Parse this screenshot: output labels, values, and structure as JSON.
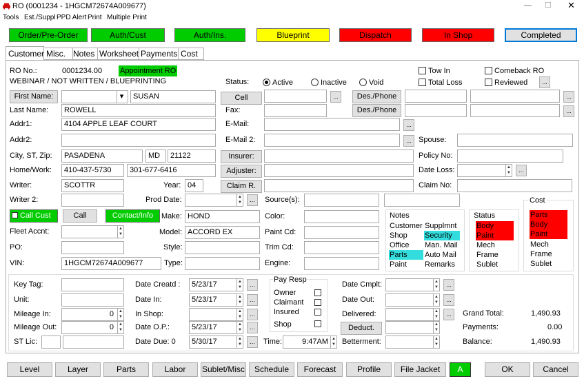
{
  "window": {
    "title": "RO (0001234 - 1HGCM72674A009677)",
    "minimize": "—",
    "maximize": "☐",
    "close": "✕"
  },
  "menu": [
    "Tools",
    "Est./Suppl",
    "PPD Alert",
    "Print",
    "Multiple Print"
  ],
  "topbuttons": [
    {
      "label": "Order/Pre-Order",
      "color": "#00cc00"
    },
    {
      "label": "Auth/Cust",
      "color": "#00cc00"
    },
    {
      "label": "Auth/Ins.",
      "color": "#00cc00"
    },
    {
      "label": "Blueprint",
      "color": "#ffff00"
    },
    {
      "label": "Dispatch",
      "color": "#ff0000"
    },
    {
      "label": "In Shop",
      "color": "#ff0000"
    },
    {
      "label": "Completed",
      "color": "#e1e1e1"
    }
  ],
  "tabs": [
    "Customer",
    "Misc.",
    "Notes",
    "Worksheet",
    "Payments",
    "Cost"
  ],
  "header": {
    "ro_label": "RO No.:",
    "ro_value": "0001234.00",
    "appointment": "Appointment RO",
    "subtitle": "WEBINAR / NOT WRITTEN / BLUEPRINTING",
    "status_label": "Status:",
    "radio_active": "Active",
    "radio_inactive": "Inactive",
    "radio_void": "Void",
    "tow_in": "Tow In",
    "total_loss": "Total Loss",
    "comeback": "Comeback RO",
    "reviewed": "Reviewed",
    "ellipsis": "..."
  },
  "customer": {
    "first_name_btn": "First Name:",
    "first_name": "SUSAN",
    "first_name_title": "",
    "last_name_label": "Last Name:",
    "last_name": "ROWELL",
    "addr1_label": "Addr1:",
    "addr1": "4104 APPLE LEAF COURT",
    "addr2_label": "Addr2:",
    "addr2": "",
    "csz_label": "City, ST, Zip:",
    "city": "PASADENA",
    "state": "MD",
    "zip": "21122",
    "hw_label": "Home/Work:",
    "home": "410-437-5730",
    "work": "301-677-6416",
    "writer_label": "Writer:",
    "writer": "SCOTTR",
    "writer2_label": "Writer 2:",
    "writer2": "",
    "call_cust": "Call Cust",
    "call": "Call",
    "contact_info": "Contact/Info",
    "fleet_label": "Fleet Accnt:",
    "po_label": "PO:",
    "vin_label": "VIN:",
    "vin": "1HGCM72674A009677",
    "cell_btn": "Cell",
    "fax_label": "Fax:",
    "email_label": "E-Mail:",
    "email2_label": "E-Mail 2:",
    "insurer_btn": "Insurer:",
    "adjuster_btn": "Adjuster:",
    "claim_btn": "Claim R.",
    "desphone1": "Des./Phone",
    "desphone2": "Des./Phone",
    "spouse_label": "Spouse:",
    "policy_label": "Policy No:",
    "dateloss_label": "Date Loss:",
    "claimno_label": "Claim No:",
    "year_label": "Year:",
    "year": "04",
    "proddate_label": "Prod Date:",
    "make_label": "Make:",
    "make": "HOND",
    "model_label": "Model:",
    "model": "ACCORD EX",
    "style_label": "Style:",
    "type_label": "Type:",
    "source_label": "Source(s):",
    "color_label": "Color:",
    "paintcd_label": "Paint Cd:",
    "trimcd_label": "Trim Cd:",
    "engine_label": "Engine:"
  },
  "notes": {
    "title": "Notes",
    "items": [
      {
        "label": "Customer",
        "hl": ""
      },
      {
        "label": "Supplmnt",
        "hl": ""
      },
      {
        "label": "Shop",
        "hl": ""
      },
      {
        "label": "Security",
        "hl": "#33dddd"
      },
      {
        "label": "Office",
        "hl": ""
      },
      {
        "label": "Man. Mail",
        "hl": ""
      },
      {
        "label": "Parts",
        "hl": "#33dddd"
      },
      {
        "label": "Auto Mail",
        "hl": ""
      },
      {
        "label": "Paint",
        "hl": ""
      },
      {
        "label": "Remarks",
        "hl": ""
      }
    ]
  },
  "status_panel": {
    "title": "Status",
    "items": [
      {
        "label": "Body",
        "hl": "#ff0000"
      },
      {
        "label": "Paint",
        "hl": "#ff0000"
      },
      {
        "label": "Mech",
        "hl": ""
      },
      {
        "label": "Frame",
        "hl": ""
      },
      {
        "label": "Sublet",
        "hl": ""
      }
    ]
  },
  "cost_panel": {
    "title": "Cost",
    "items": [
      {
        "label": "Parts",
        "hl": "#ff0000"
      },
      {
        "label": "Body",
        "hl": "#ff0000"
      },
      {
        "label": "Paint",
        "hl": "#ff0000"
      },
      {
        "label": "Mech",
        "hl": ""
      },
      {
        "label": "Frame",
        "hl": ""
      },
      {
        "label": "Sublet",
        "hl": ""
      }
    ]
  },
  "bottom": {
    "keytag_label": "Key Tag:",
    "unit_label": "Unit:",
    "milein_label": "Mileage In:",
    "milein": "0",
    "mileout_label": "Mileage Out:",
    "mileout": "0",
    "stlic_label": "ST Lic:",
    "datecreated_label": "Date Creatd :",
    "datecreated": "5/23/17",
    "datein_label": "Date In:",
    "datein": "5/23/17",
    "inshop_label": "In Shop:",
    "inshop": "",
    "dateop_label": "Date O.P.:",
    "dateop": "5/23/17",
    "datedue_label": "Date Due: 0",
    "datedue": "5/30/17",
    "payresp": "Pay Resp",
    "owner": "Owner",
    "claimant": "Claimant",
    "insured": "Insured",
    "shop": "Shop",
    "time_label": "Time:",
    "time": "9:47AM",
    "datecmplt_label": "Date Cmplt:",
    "dateout_label": "Date Out:",
    "delivered_label": "Delivered:",
    "deduct_btn": "Deduct.",
    "betterment_label": "Betterment:",
    "grandtotal_label": "Grand Total:",
    "grandtotal": "1,490.93",
    "payments_label": "Payments:",
    "payments": "0.00",
    "balance_label": "Balance:",
    "balance": "1,490.93"
  },
  "toolbar": [
    "Level",
    "Layer",
    "Parts",
    "Labor",
    "Sublet/Misc",
    "Schedule",
    "Forecast",
    "Profile",
    "File Jacket"
  ],
  "toolbar_a": "A",
  "ok": "OK",
  "cancel": "Cancel",
  "icons": {
    "car": "car-icon",
    "dropdown": "▾",
    "spinner": "▲▼"
  }
}
